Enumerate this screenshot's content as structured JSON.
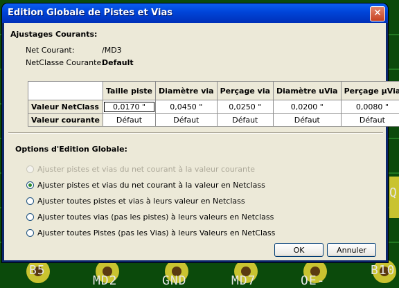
{
  "window": {
    "title": "Edition Globale de Pistes et Vias",
    "close_symbol": "✕"
  },
  "current": {
    "section_title": "Ajustages Courants:",
    "net_label": "Net Courant:",
    "net_value": "/MD3",
    "netclass_label": "NetClasse Courante:",
    "netclass_value": "Default"
  },
  "grid": {
    "columns": [
      "Taille piste",
      "Diamètre via",
      "Perçage via",
      "Diamètre uVia",
      "Perçage µVia"
    ],
    "rows": [
      {
        "label": "Valeur NetClass",
        "values": [
          "0,0170 \"",
          "0,0450 \"",
          "0,0250 \"",
          "0,0200 \"",
          "0,0080 \""
        ]
      },
      {
        "label": "Valeur courante",
        "values": [
          "Défaut",
          "Défaut",
          "Défaut",
          "Défaut",
          "Défaut"
        ]
      }
    ]
  },
  "options": {
    "section_title": "Options d'Edition Globale:",
    "items": [
      {
        "label": "Ajuster pistes et vias du net courant à la valeur courante",
        "checked": false,
        "disabled": true
      },
      {
        "label": "Ajuster pistes et vias du net courant à la valeur en Netclass",
        "checked": true,
        "disabled": false
      },
      {
        "label": "Ajuster toutes pistes et vias à leurs valeur en Netclass",
        "checked": false,
        "disabled": false
      },
      {
        "label": "Ajuster toutes vias (pas les pistes) à leurs valeurs en Netclass",
        "checked": false,
        "disabled": false
      },
      {
        "label": "Ajuster toutes Pistes (pas les Vias) à leurs Valeurs en NetClass",
        "checked": false,
        "disabled": false
      }
    ]
  },
  "buttons": {
    "ok": "OK",
    "cancel": "Annuler"
  },
  "background": {
    "pads": [
      "B5",
      "MD2",
      "GND",
      "MD7",
      "OE-",
      "B10",
      "Q"
    ]
  },
  "colors": {
    "pcb_green": "#0b4a0b",
    "titlebar_blue": "#0054e3",
    "dialog_face": "#ece9d8",
    "close_red": "#c74221"
  }
}
